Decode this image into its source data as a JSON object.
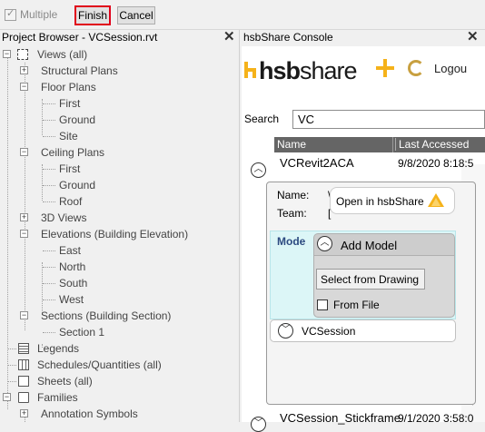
{
  "toolbar": {
    "multiple_label": "Multiple",
    "finish_label": "Finish",
    "cancel_label": "Cancel"
  },
  "project_browser": {
    "title": "Project Browser - VCSession.rvt",
    "close": "✕",
    "items": [
      {
        "label": "Views (all)",
        "expander": "−"
      },
      {
        "label": "Structural Plans",
        "expander": "+"
      },
      {
        "label": "Floor Plans",
        "expander": "−"
      },
      {
        "label": "First"
      },
      {
        "label": "Ground"
      },
      {
        "label": "Site"
      },
      {
        "label": "Ceiling Plans",
        "expander": "−"
      },
      {
        "label": "First"
      },
      {
        "label": "Ground"
      },
      {
        "label": "Roof"
      },
      {
        "label": "3D Views",
        "expander": "+"
      },
      {
        "label": "Elevations (Building Elevation)",
        "expander": "−"
      },
      {
        "label": "East"
      },
      {
        "label": "North"
      },
      {
        "label": "South"
      },
      {
        "label": "West"
      },
      {
        "label": "Sections (Building Section)",
        "expander": "−"
      },
      {
        "label": "Section 1"
      },
      {
        "label": "Legends"
      },
      {
        "label": "Schedules/Quantities (all)"
      },
      {
        "label": "Sheets (all)"
      },
      {
        "label": "Families",
        "expander": "−"
      },
      {
        "label": "Annotation Symbols",
        "expander": "+"
      }
    ]
  },
  "console": {
    "title": "hsbShare Console",
    "close": "✕",
    "logo_hsb": "hsb",
    "logo_share": "share",
    "logout_label": "Logou",
    "search_label": "Search",
    "search_value": "VC",
    "col_name": "Name",
    "col_last_accessed": "Last Accessed",
    "rows": [
      {
        "name": "VCRevit2ACA",
        "date": "9/8/2020 8:18:5"
      },
      {
        "name": "VCSession_Stickframe",
        "date": "9/1/2020 3:58:0"
      }
    ],
    "detail": {
      "name_label": "Name:",
      "team_label": "Team:",
      "name_value_fragment": "\\",
      "team_value_fragment": "[",
      "open_label": "Open in hsbShare",
      "mode_label": "Mode",
      "add_model_label": "Add Model",
      "select_from_drawing_label": "Select from Drawing",
      "from_file_label": "From File",
      "session_label": "VCSession"
    },
    "colors": {
      "accent": "#f5b21a",
      "header_bg": "#656565",
      "mode_bg": "#dcf6f7"
    }
  }
}
